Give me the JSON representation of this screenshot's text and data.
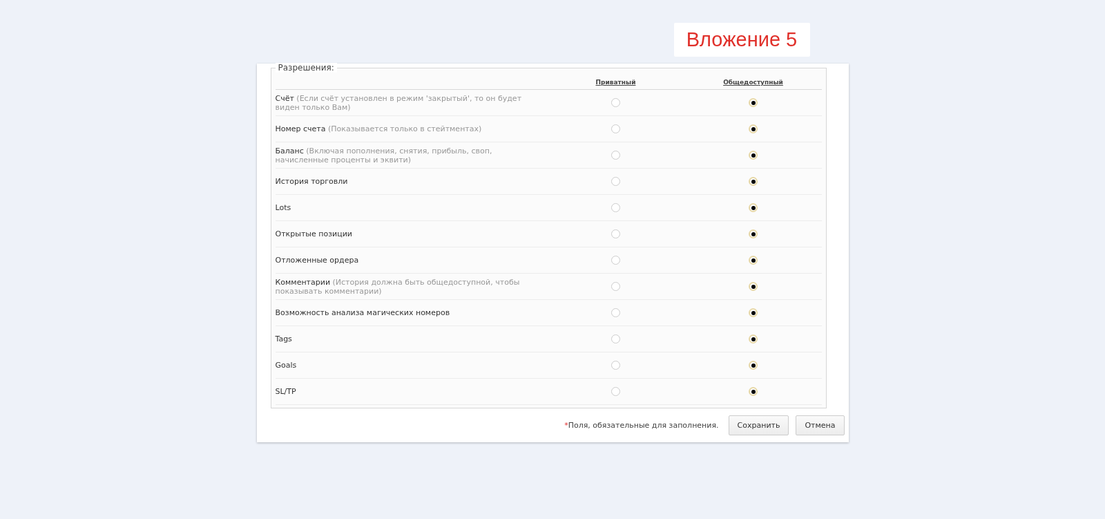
{
  "badge": "Вложение 5",
  "permissions": {
    "legend": "Разрешения:",
    "columns": [
      "Приватный",
      "Общедоступный"
    ],
    "rows": [
      {
        "label": "Счёт",
        "note": "(Если счёт установлен в режим 'закрытый', то он будет виден только Вам)",
        "options": [
          {
            "selected": false
          },
          {
            "selected": true
          }
        ]
      },
      {
        "label": "Номер счета",
        "note": "(Показывается только в стейтментах)",
        "options": [
          {
            "selected": false
          },
          {
            "selected": true
          }
        ]
      },
      {
        "label": "Баланс",
        "note": "(Включая пополнения, снятия, прибыль, своп, начисленные проценты и эквити)",
        "options": [
          {
            "selected": false
          },
          {
            "selected": true
          }
        ]
      },
      {
        "label": "История торговли",
        "options": [
          {
            "selected": false
          },
          {
            "selected": true
          }
        ]
      },
      {
        "label": "Lots",
        "options": [
          {
            "selected": false
          },
          {
            "selected": true
          }
        ]
      },
      {
        "label": "Открытые позиции",
        "options": [
          {
            "selected": false
          },
          {
            "selected": true
          }
        ]
      },
      {
        "label": "Отложенные ордера",
        "options": [
          {
            "selected": false
          },
          {
            "selected": true
          }
        ]
      },
      {
        "label": "Комментарии",
        "note": "(История должна быть общедоступной, чтобы показывать комментарии)",
        "options": [
          {
            "selected": false
          },
          {
            "selected": true
          }
        ]
      },
      {
        "label": "Возможность анализа магических номеров",
        "options": [
          {
            "selected": false
          },
          {
            "selected": true
          }
        ]
      },
      {
        "label": "Tags",
        "options": [
          {
            "selected": false
          },
          {
            "selected": true
          }
        ]
      },
      {
        "label": "Goals",
        "options": [
          {
            "selected": false
          },
          {
            "selected": true
          }
        ]
      },
      {
        "label": "SL/TP",
        "options": [
          {
            "selected": false
          },
          {
            "selected": true
          }
        ]
      }
    ]
  },
  "footer": {
    "required_mark": "*",
    "required_note": "Поля, обязательные для заполнения.",
    "buttons": [
      "Сохранить",
      "Отмена"
    ]
  }
}
